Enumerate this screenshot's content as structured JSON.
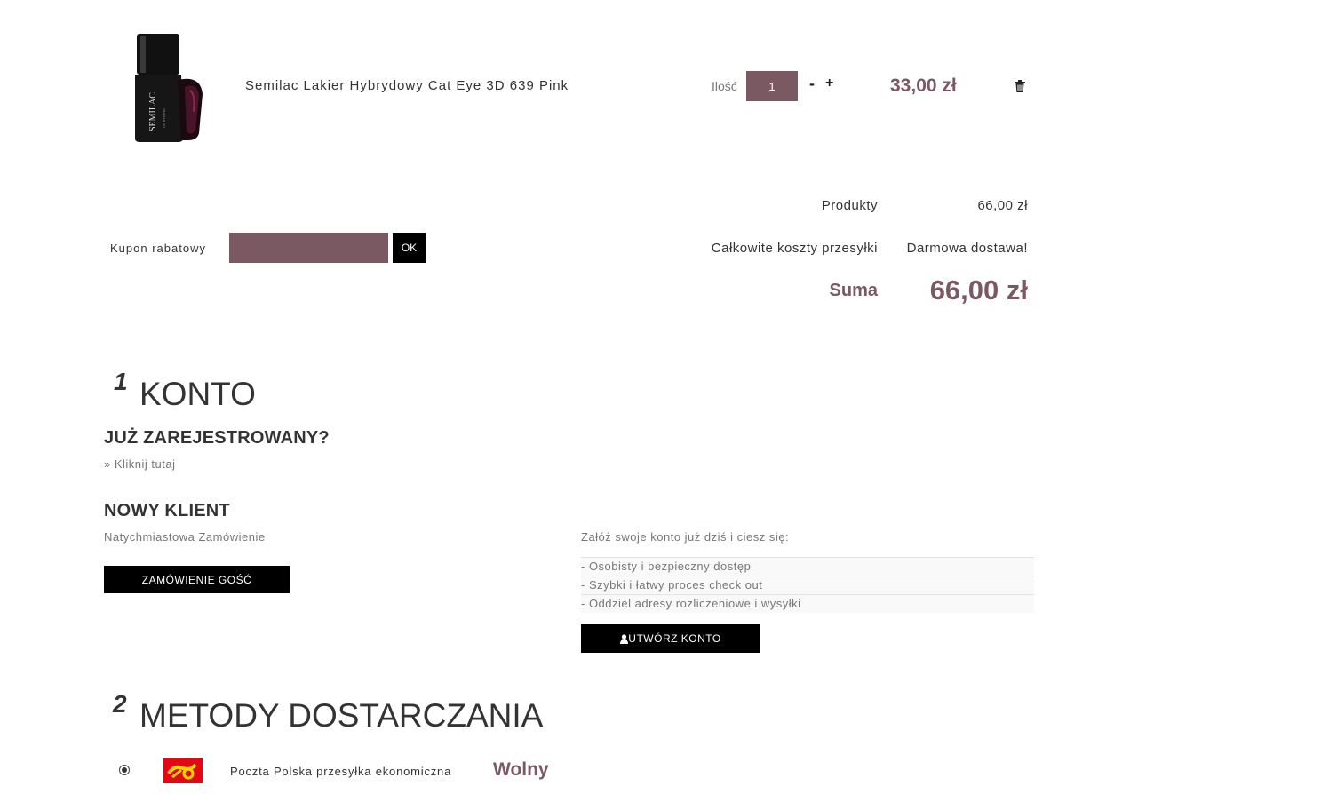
{
  "cart": {
    "product_name": "Semilac Lakier Hybrydowy Cat Eye 3D 639 Pink",
    "qty_label": "Ilość",
    "qty_value": "1",
    "minus": "-",
    "plus": "+",
    "line_price": "33,00 zł",
    "bottle_brand": "SEMILAC",
    "bottle_sub": "UV HYBRID"
  },
  "coupon": {
    "label": "Kupon rabatowy",
    "ok": "OK"
  },
  "totals": {
    "products_label": "Produkty",
    "products_value": "66,00 zł",
    "shipping_label": "Całkowite koszty przesyłki",
    "shipping_value": "Darmowa dostawa!",
    "sum_label": "Suma",
    "sum_value": "66,00 zł"
  },
  "account": {
    "num": "1",
    "title": "KONTO",
    "registered_title": "JUŻ ZAREJESTROWANY?",
    "login_link": "» Kliknij tutaj",
    "new_title": "NOWY KLIENT",
    "new_sub": "Natychmiastowa Zamówienie",
    "guest_button": "ZAMÓWIENIE GOŚĆ",
    "benefits_intro": "Załóż swoje konto już dziś i ciesz się:",
    "benefits": [
      "- Osobisty i bezpieczny dostęp",
      "- Szybki i łatwy proces check out",
      "- Oddziel adresy rozliczeniowe i wysyłki"
    ],
    "create_button": "UTWÓRZ KONTO"
  },
  "delivery": {
    "num": "2",
    "title": "METODY DOSTARCZANIA",
    "option_name": "Poczta Polska przesyłka ekonomiczna",
    "option_price": "Wolny",
    "option_selected": true
  },
  "colors": {
    "accent": "#7b5963",
    "button": "#000000",
    "poczta": "#e30613"
  }
}
